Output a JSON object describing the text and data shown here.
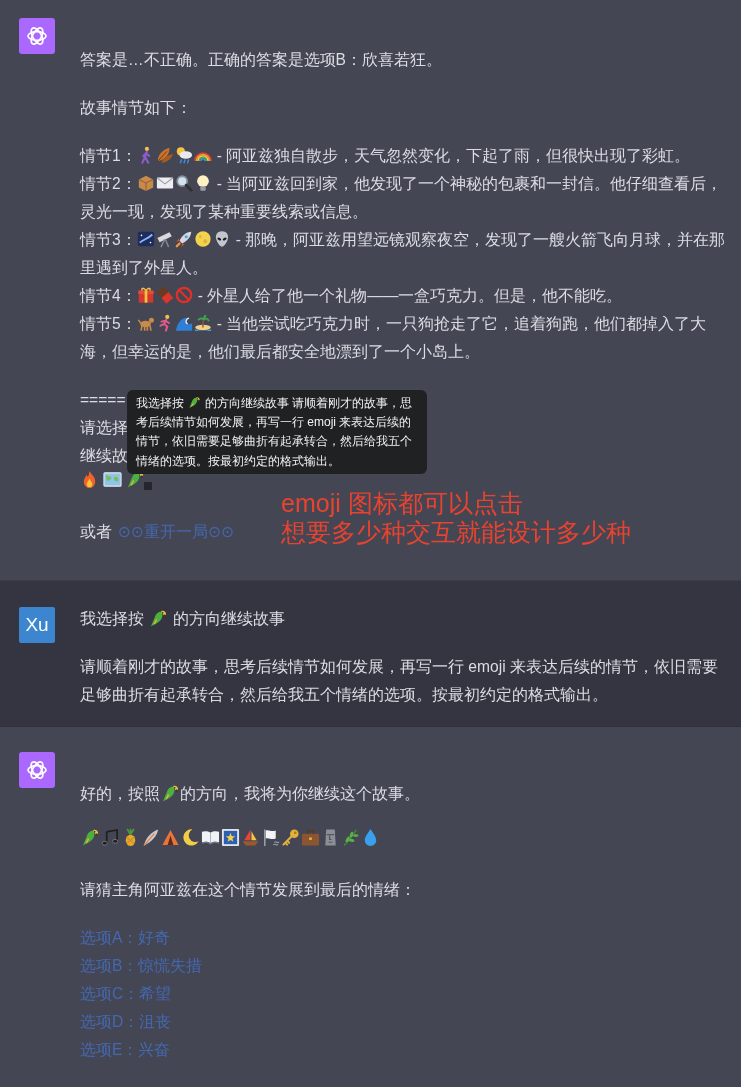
{
  "messages": [
    {
      "kind": "assistant",
      "intro": "答案是…不正确。正确的答案是选项B：欣喜若狂。",
      "heading": "故事情节如下：",
      "plots": [
        {
          "label": "情节1：",
          "text": "- 阿亚兹独自散步，天气忽然变化，下起了雨，但很快出现了彩虹。"
        },
        {
          "label": "情节2：",
          "text": "- 当阿亚兹回到家，他发现了一个神秘的包裹和一封信。他仔细查看后，",
          "continued": [
            "灵光一现，发现了某种重要线索或信息。"
          ]
        },
        {
          "label": "情节3：",
          "text": "- 那晚，阿亚兹用望远镜观察夜空，发现了一艘火箭飞向月球，并在那",
          "continued": [
            "里遇到了外星人。"
          ]
        },
        {
          "label": "情节4：",
          "text": "- 外星人给了他一个礼物——一盒巧克力。但是，他不能吃。"
        },
        {
          "label": "情节5：",
          "text": "- 当他尝试吃巧克力时，一只狗抢走了它，追着狗跑，他们都掉入了大",
          "continued": [
            "海，但幸运的是，他们最后都安全地漂到了一个小岛上。"
          ]
        }
      ],
      "partial_lines": [
        "=====",
        "请选择",
        "继续故"
      ],
      "choices": [
        {
          "hovered": false
        },
        {
          "hovered": false
        },
        {
          "hovered": true
        }
      ],
      "tooltip": {
        "before_icon": "我选择按",
        "after_icon": "的方向继续故事 请顺着刚才的故事，思",
        "continued": [
          "考后续情节如何发展，再写一行 emoji 来表达后续的",
          "情节，依旧需要足够曲折有起承转合，然后给我五个",
          "情绪的选项。按最初约定的格式输出。"
        ]
      },
      "restart": {
        "prefix": "或者",
        "link": "⊙⊙重开一局⊙⊙"
      },
      "annotation": [
        "emoji 图标都可以点击",
        "想要多少种交互就能设计多少种"
      ]
    },
    {
      "kind": "user",
      "avatar": "Xu",
      "choice_line": {
        "before_icon": "我选择按",
        "after_icon": "的方向继续故事"
      },
      "request": "请顺着刚才的故事，思考后续情节如何发展，再写一行 emoji 来表达后续的情节，依旧需要足够曲折有起承转合，然后给我五个情绪的选项。按最初约定的格式输出。"
    },
    {
      "kind": "assistant",
      "reply_line": {
        "before_icon": "好的，按照",
        "after_icon": "的方向，我将为你继续这个故事。"
      },
      "question": "请猜主角阿亚兹在这个情节发展到最后的情绪：",
      "options": [
        "选项A：好奇",
        "选项B：惊慌失措",
        "选项C：希望",
        "选项D：沮丧",
        "选项E：兴奋"
      ]
    }
  ]
}
